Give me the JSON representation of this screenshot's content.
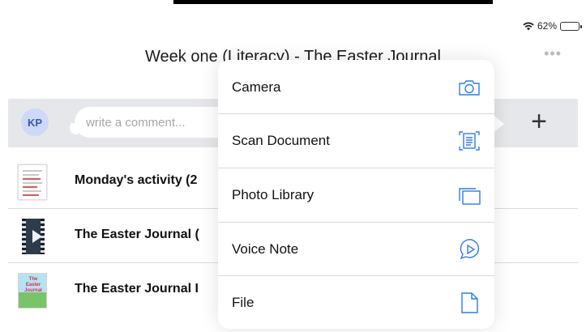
{
  "status": {
    "battery": "62%"
  },
  "header": {
    "title": "Week one (Literacy) - The Easter Journal",
    "more": "•••"
  },
  "comment": {
    "avatar_initials": "KP",
    "placeholder": "write a comment...",
    "add": "+"
  },
  "rows": [
    {
      "title": "Monday's activity (2",
      "thumb": "document-thumbnail"
    },
    {
      "title": "The Easter Journal (",
      "thumb": "video-thumbnail"
    },
    {
      "title": "The Easter Journal I",
      "thumb": "book-cover-thumbnail",
      "thumb_text": "The Easter Journal"
    }
  ],
  "menu": [
    {
      "label": "Camera",
      "icon": "camera-icon"
    },
    {
      "label": "Scan Document",
      "icon": "scan-document-icon"
    },
    {
      "label": "Photo Library",
      "icon": "photo-library-icon"
    },
    {
      "label": "Voice Note",
      "icon": "voice-note-icon"
    },
    {
      "label": "File",
      "icon": "file-icon"
    }
  ],
  "colors": {
    "accent": "#2f7de1",
    "comment_bar": "#e6e7ea",
    "avatar_bg": "#cdd9f6",
    "avatar_text": "#3159b8"
  }
}
